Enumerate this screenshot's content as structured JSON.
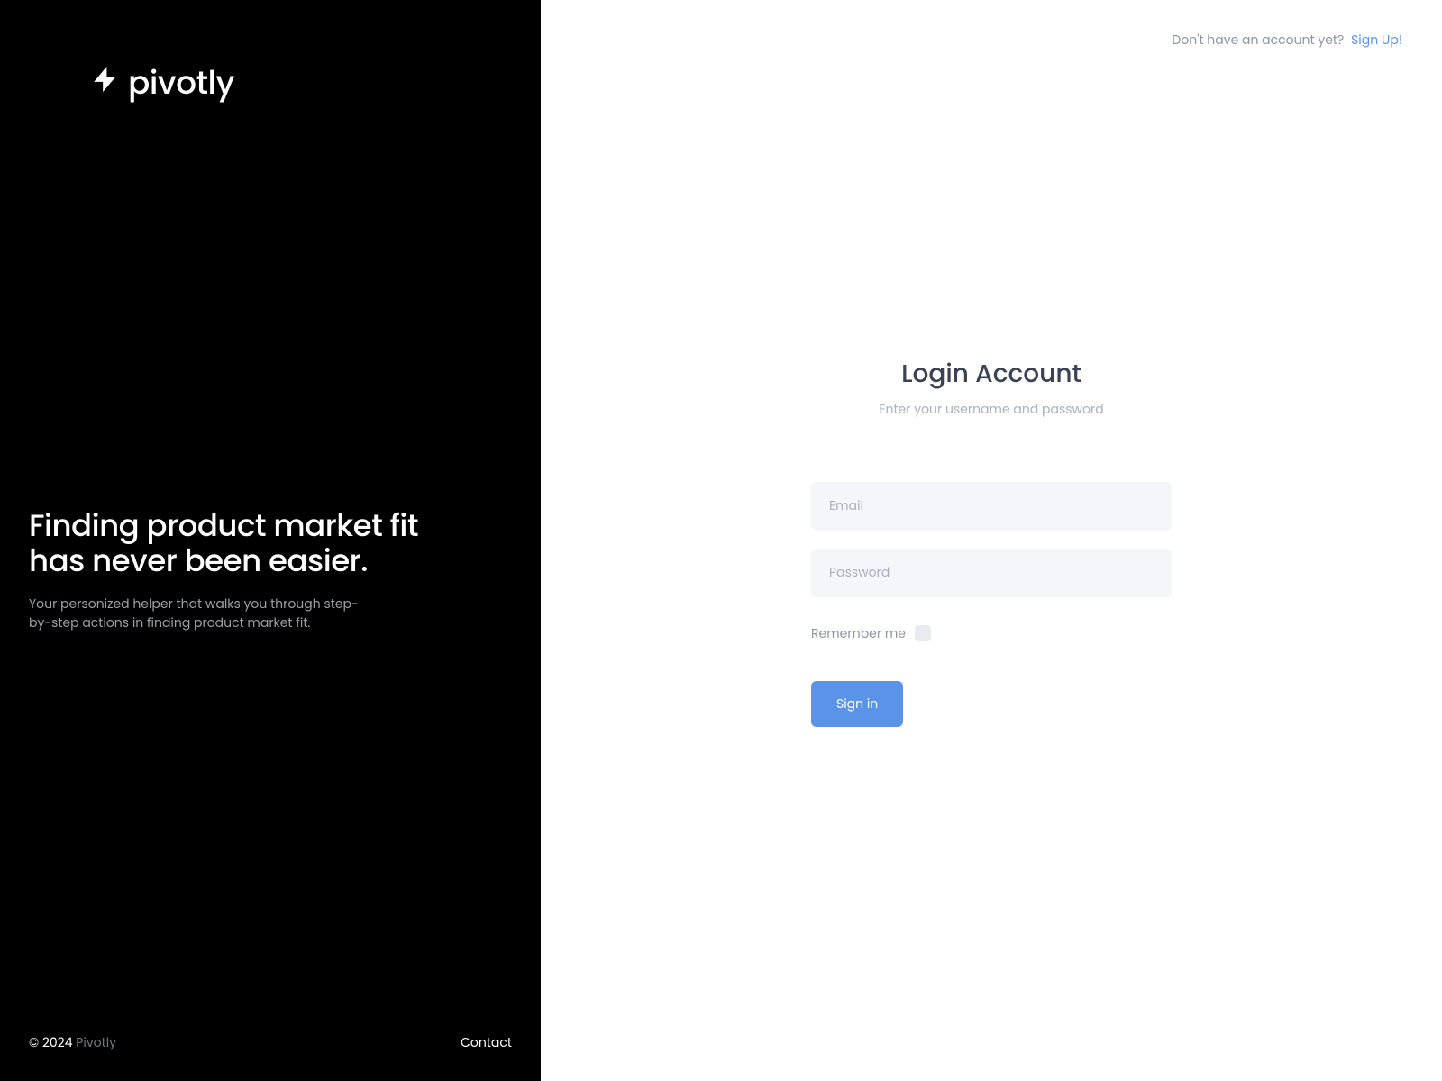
{
  "brand": {
    "name": "pivotly"
  },
  "hero": {
    "headline": "Finding product market fit\nhas never been easier.",
    "subhead": "Your personized helper that walks you through step-by-step actions in finding product market fit."
  },
  "footer": {
    "copyright_prefix": "© 2024 ",
    "copyright_brand": "Pivotly",
    "contact": "Contact"
  },
  "topbar": {
    "no_account": "Don't have an account yet?",
    "signup": "Sign Up!"
  },
  "form": {
    "title": "Login Account",
    "subtitle": "Enter your username and password",
    "email_placeholder": "Email",
    "password_placeholder": "Password",
    "remember_label": "Remember me",
    "signin_label": "Sign in"
  }
}
